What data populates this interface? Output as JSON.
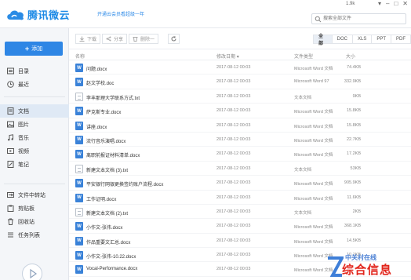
{
  "app": {
    "logo_text": "腾讯微云",
    "promo": "开通云会员看超级一年",
    "user": "1.9k",
    "window_buttons": [
      "▾",
      "–",
      "□",
      "✕"
    ]
  },
  "search": {
    "placeholder": "搜索全部文件"
  },
  "sidebar": {
    "upload_label": "添加",
    "items": [
      {
        "label": "目录",
        "icon": "folder-icon"
      },
      {
        "label": "最近",
        "icon": "clock-icon"
      },
      {
        "label": "文档",
        "icon": "document-icon",
        "active": true
      },
      {
        "label": "图片",
        "icon": "image-icon"
      },
      {
        "label": "音乐",
        "icon": "music-icon"
      },
      {
        "label": "视频",
        "icon": "video-icon"
      },
      {
        "label": "笔记",
        "icon": "note-icon"
      },
      {
        "label": "文件中转站",
        "icon": "transfer-icon"
      },
      {
        "label": "剪贴板",
        "icon": "clipboard-icon"
      },
      {
        "label": "回收站",
        "icon": "trash-icon"
      },
      {
        "label": "任务列表",
        "icon": "tasks-icon"
      }
    ]
  },
  "toolbar": {
    "download_label": "下载",
    "share_label": "分享",
    "delete_label": "删除一",
    "filters": [
      "全部",
      "DOC",
      "XLS",
      "PPT",
      "PDF"
    ]
  },
  "table": {
    "headers": {
      "name": "名称",
      "date": "修改日期",
      "type": "文件类型",
      "size": "大小"
    },
    "rows": [
      {
        "icon": "word",
        "name": "问题.docx",
        "date": "2017-08-12 00:03",
        "type": "Microsoft Word 文档",
        "size": "74.4KB"
      },
      {
        "icon": "word",
        "name": "赵文学校.doc",
        "date": "2017-08-12 00:03",
        "type": "Microsoft Word 97",
        "size": "332.9KB"
      },
      {
        "icon": "txt",
        "name": "李丰那理大学联系方式.txt",
        "date": "2017-08-12 00:03",
        "type": "文本文档",
        "size": "9KB"
      },
      {
        "icon": "word",
        "name": "萨克斯专业.docx",
        "date": "2017-08-12 00:03",
        "type": "Microsoft Word 文档",
        "size": "15.8KB"
      },
      {
        "icon": "word",
        "name": "讲座.docx",
        "date": "2017-08-12 00:03",
        "type": "Microsoft Word 文档",
        "size": "15.8KB"
      },
      {
        "icon": "word",
        "name": "流行音乐演唱.docx",
        "date": "2017-08-12 00:03",
        "type": "Microsoft Word 文档",
        "size": "22.7KB"
      },
      {
        "icon": "word",
        "name": "离职前报证材料清单.docx",
        "date": "2017-08-12 00:03",
        "type": "Microsoft Word 文档",
        "size": "17.2KB"
      },
      {
        "icon": "txt",
        "name": "新建文本文档 (3).txt",
        "date": "2017-08-12 00:03",
        "type": "文本文档",
        "size": "53KB"
      },
      {
        "icon": "word",
        "name": "平安银行网银更换签约账户流程.docx",
        "date": "2017-08-12 00:03",
        "type": "Microsoft Word 文档",
        "size": "905.9KB"
      },
      {
        "icon": "word",
        "name": "工作证明.docx",
        "date": "2017-08-12 00:03",
        "type": "Microsoft Word 文档",
        "size": "11.6KB"
      },
      {
        "icon": "txt",
        "name": "新建文本文档 (2).txt",
        "date": "2017-08-12 00:03",
        "type": "文本文档",
        "size": "2KB"
      },
      {
        "icon": "word",
        "name": "小作文-张伟.docx",
        "date": "2017-08-12 00:03",
        "type": "Microsoft Word 文档",
        "size": "368.1KB"
      },
      {
        "icon": "word",
        "name": "作品重要文汇总.docx",
        "date": "2017-08-12 00:03",
        "type": "Microsoft Word 文档",
        "size": "14.5KB"
      },
      {
        "icon": "word",
        "name": "小作文-张伟-10.22.docx",
        "date": "2017-08-12 00:03",
        "type": "Microsoft Word 文档",
        "size": "10.1KB"
      },
      {
        "icon": "word",
        "name": "Vocal-Performance.docx",
        "date": "2017-08-12 00:03",
        "type": "Microsoft Word 文档",
        "size": ""
      }
    ]
  },
  "watermark": {
    "sub": "中关村在线",
    "text": "综合信息"
  }
}
